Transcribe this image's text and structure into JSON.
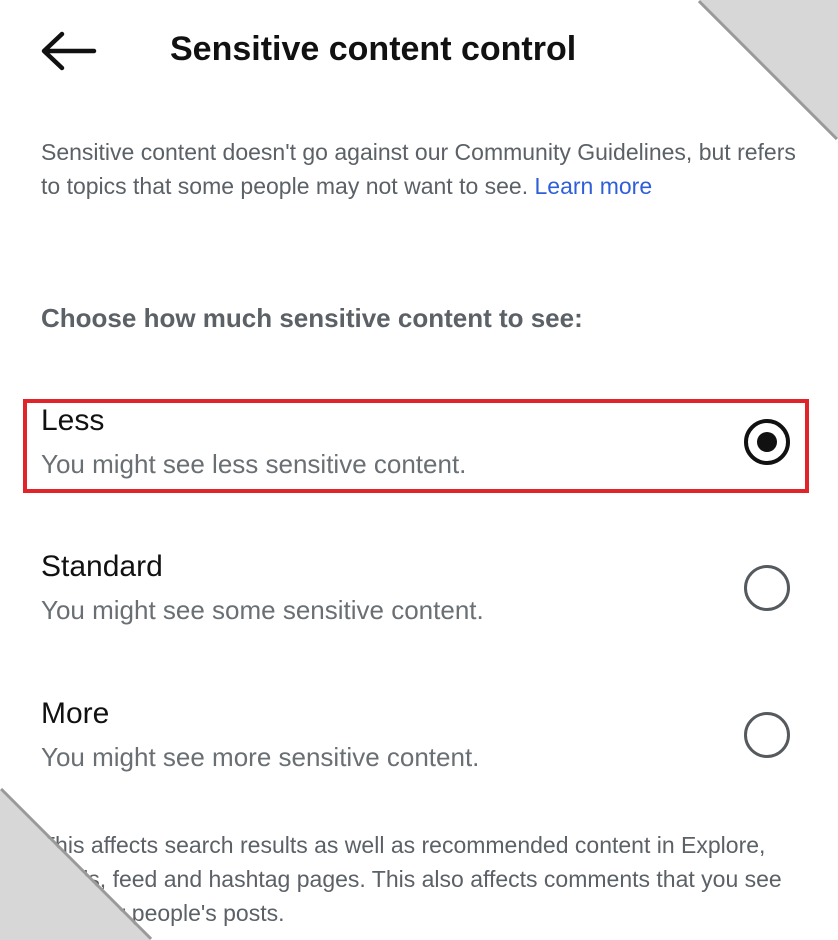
{
  "header": {
    "back_icon": "arrow-left-icon",
    "title": "Sensitive content control"
  },
  "intro": {
    "text": "Sensitive content doesn't go against our Community Guidelines, but refers to topics that some people may not want to see.",
    "link": "Learn more",
    "link_color": "#2f5fd8"
  },
  "question": "Choose how much sensitive content to see:",
  "options": [
    {
      "label": "Less",
      "description": "You might see less sensitive content.",
      "selected": true
    },
    {
      "label": "Standard",
      "description": "You might see some sensitive content.",
      "selected": false
    },
    {
      "label": "More",
      "description": "You might see more sensitive content.",
      "selected": false
    }
  ],
  "highlight_color": "#e0242a",
  "footer_note": "This affects search results as well as recommended content in Explore, Reels, feed and hashtag pages. This also affects comments that you see on other people's posts."
}
